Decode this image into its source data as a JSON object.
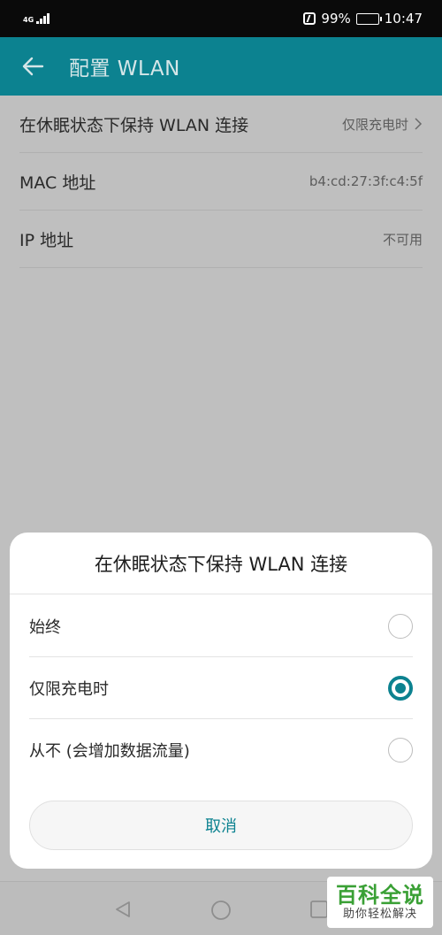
{
  "status_bar": {
    "network_type": "4G",
    "battery_percent": "99%",
    "time": "10:47",
    "icons": [
      "signal-icon",
      "nfc-icon",
      "battery-icon"
    ]
  },
  "app_bar": {
    "title": "配置 WLAN",
    "back_icon": "arrow-left-icon",
    "color": "#0c8290"
  },
  "settings": [
    {
      "label": "在休眠状态下保持 WLAN 连接",
      "value": "仅限充电时",
      "has_chevron": true
    },
    {
      "label": "MAC 地址",
      "value": "b4:cd:27:3f:c4:5f",
      "has_chevron": false
    },
    {
      "label": "IP 地址",
      "value": "不可用",
      "has_chevron": false
    }
  ],
  "dialog": {
    "title": "在休眠状态下保持 WLAN 连接",
    "options": [
      {
        "label": "始终",
        "selected": false
      },
      {
        "label": "仅限充电时",
        "selected": true
      },
      {
        "label": "从不 (会增加数据流量)",
        "selected": false
      }
    ],
    "cancel_label": "取消",
    "accent_color": "#0c8290"
  },
  "nav_bar": {
    "icons": [
      "back-triangle-icon",
      "home-circle-icon",
      "recents-square-icon"
    ]
  },
  "watermark": {
    "main": "百科全说",
    "sub": "助你轻松解决"
  }
}
